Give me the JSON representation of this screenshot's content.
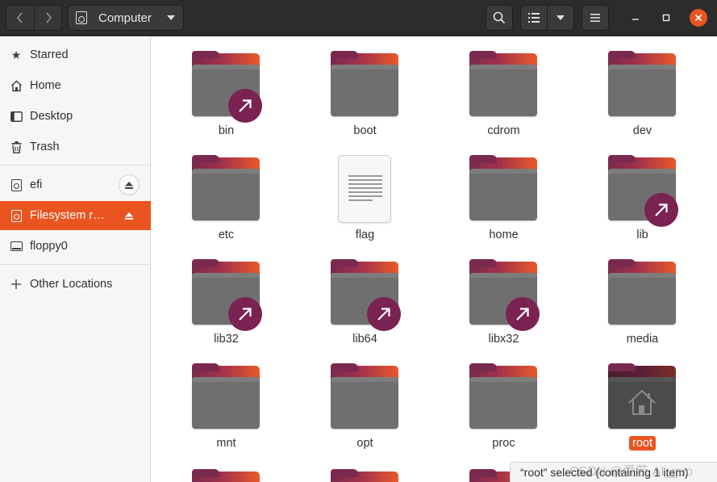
{
  "window": {
    "location_label": "Computer",
    "accent_color": "#e95420",
    "headerbar_color": "#2c2c2c"
  },
  "toolbar": {
    "back_icon": "chevron-left-icon",
    "forward_icon": "chevron-right-icon",
    "search_icon": "search-icon",
    "view_icon": "list-view-icon",
    "view_menu_icon": "chevron-down-icon",
    "menu_icon": "hamburger-menu-icon",
    "minimize_glyph": "–",
    "maximize_glyph": "□",
    "close_glyph": "✕"
  },
  "sidebar": {
    "places": [
      {
        "label": "Starred",
        "icon": "star-icon"
      },
      {
        "label": "Home",
        "icon": "home-icon"
      },
      {
        "label": "Desktop",
        "icon": "desktop-icon"
      },
      {
        "label": "Trash",
        "icon": "trash-icon"
      }
    ],
    "devices": [
      {
        "label": "efi",
        "icon": "drive-icon",
        "eject": true
      },
      {
        "label": "Filesystem r…",
        "icon": "drive-icon",
        "eject": true,
        "active": true
      },
      {
        "label": "floppy0",
        "icon": "floppy-icon",
        "eject": false
      }
    ],
    "other": {
      "label": "Other Locations",
      "icon": "plus-icon"
    }
  },
  "files": [
    {
      "name": "bin",
      "type": "folder",
      "symlink": true
    },
    {
      "name": "boot",
      "type": "folder"
    },
    {
      "name": "cdrom",
      "type": "folder"
    },
    {
      "name": "dev",
      "type": "folder"
    },
    {
      "name": "etc",
      "type": "folder"
    },
    {
      "name": "flag",
      "type": "text-file"
    },
    {
      "name": "home",
      "type": "folder"
    },
    {
      "name": "lib",
      "type": "folder",
      "symlink": true
    },
    {
      "name": "lib32",
      "type": "folder",
      "symlink": true
    },
    {
      "name": "lib64",
      "type": "folder",
      "symlink": true
    },
    {
      "name": "libx32",
      "type": "folder",
      "symlink": true
    },
    {
      "name": "media",
      "type": "folder"
    },
    {
      "name": "mnt",
      "type": "folder"
    },
    {
      "name": "opt",
      "type": "folder"
    },
    {
      "name": "proc",
      "type": "folder"
    },
    {
      "name": "root",
      "type": "folder",
      "selected": true,
      "emblem": "home-icon"
    }
  ],
  "status": {
    "text": "“root” selected  (containing 1 item)"
  },
  "watermark": "CSDN @爱若 AI_guo"
}
